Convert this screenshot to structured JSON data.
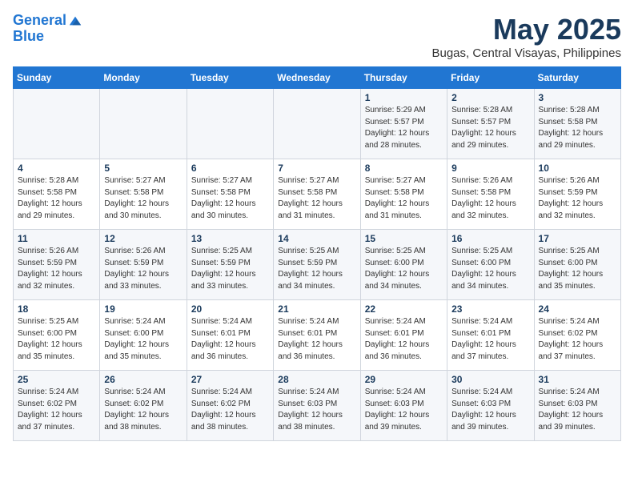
{
  "header": {
    "logo_line1": "General",
    "logo_line2": "Blue",
    "title": "May 2025",
    "subtitle": "Bugas, Central Visayas, Philippines"
  },
  "days_of_week": [
    "Sunday",
    "Monday",
    "Tuesday",
    "Wednesday",
    "Thursday",
    "Friday",
    "Saturday"
  ],
  "weeks": [
    [
      {
        "day": "",
        "sunrise": "",
        "sunset": "",
        "daylight": ""
      },
      {
        "day": "",
        "sunrise": "",
        "sunset": "",
        "daylight": ""
      },
      {
        "day": "",
        "sunrise": "",
        "sunset": "",
        "daylight": ""
      },
      {
        "day": "",
        "sunrise": "",
        "sunset": "",
        "daylight": ""
      },
      {
        "day": "1",
        "sunrise": "Sunrise: 5:29 AM",
        "sunset": "Sunset: 5:57 PM",
        "daylight": "Daylight: 12 hours and 28 minutes."
      },
      {
        "day": "2",
        "sunrise": "Sunrise: 5:28 AM",
        "sunset": "Sunset: 5:57 PM",
        "daylight": "Daylight: 12 hours and 29 minutes."
      },
      {
        "day": "3",
        "sunrise": "Sunrise: 5:28 AM",
        "sunset": "Sunset: 5:58 PM",
        "daylight": "Daylight: 12 hours and 29 minutes."
      }
    ],
    [
      {
        "day": "4",
        "sunrise": "Sunrise: 5:28 AM",
        "sunset": "Sunset: 5:58 PM",
        "daylight": "Daylight: 12 hours and 29 minutes."
      },
      {
        "day": "5",
        "sunrise": "Sunrise: 5:27 AM",
        "sunset": "Sunset: 5:58 PM",
        "daylight": "Daylight: 12 hours and 30 minutes."
      },
      {
        "day": "6",
        "sunrise": "Sunrise: 5:27 AM",
        "sunset": "Sunset: 5:58 PM",
        "daylight": "Daylight: 12 hours and 30 minutes."
      },
      {
        "day": "7",
        "sunrise": "Sunrise: 5:27 AM",
        "sunset": "Sunset: 5:58 PM",
        "daylight": "Daylight: 12 hours and 31 minutes."
      },
      {
        "day": "8",
        "sunrise": "Sunrise: 5:27 AM",
        "sunset": "Sunset: 5:58 PM",
        "daylight": "Daylight: 12 hours and 31 minutes."
      },
      {
        "day": "9",
        "sunrise": "Sunrise: 5:26 AM",
        "sunset": "Sunset: 5:58 PM",
        "daylight": "Daylight: 12 hours and 32 minutes."
      },
      {
        "day": "10",
        "sunrise": "Sunrise: 5:26 AM",
        "sunset": "Sunset: 5:59 PM",
        "daylight": "Daylight: 12 hours and 32 minutes."
      }
    ],
    [
      {
        "day": "11",
        "sunrise": "Sunrise: 5:26 AM",
        "sunset": "Sunset: 5:59 PM",
        "daylight": "Daylight: 12 hours and 32 minutes."
      },
      {
        "day": "12",
        "sunrise": "Sunrise: 5:26 AM",
        "sunset": "Sunset: 5:59 PM",
        "daylight": "Daylight: 12 hours and 33 minutes."
      },
      {
        "day": "13",
        "sunrise": "Sunrise: 5:25 AM",
        "sunset": "Sunset: 5:59 PM",
        "daylight": "Daylight: 12 hours and 33 minutes."
      },
      {
        "day": "14",
        "sunrise": "Sunrise: 5:25 AM",
        "sunset": "Sunset: 5:59 PM",
        "daylight": "Daylight: 12 hours and 34 minutes."
      },
      {
        "day": "15",
        "sunrise": "Sunrise: 5:25 AM",
        "sunset": "Sunset: 6:00 PM",
        "daylight": "Daylight: 12 hours and 34 minutes."
      },
      {
        "day": "16",
        "sunrise": "Sunrise: 5:25 AM",
        "sunset": "Sunset: 6:00 PM",
        "daylight": "Daylight: 12 hours and 34 minutes."
      },
      {
        "day": "17",
        "sunrise": "Sunrise: 5:25 AM",
        "sunset": "Sunset: 6:00 PM",
        "daylight": "Daylight: 12 hours and 35 minutes."
      }
    ],
    [
      {
        "day": "18",
        "sunrise": "Sunrise: 5:25 AM",
        "sunset": "Sunset: 6:00 PM",
        "daylight": "Daylight: 12 hours and 35 minutes."
      },
      {
        "day": "19",
        "sunrise": "Sunrise: 5:24 AM",
        "sunset": "Sunset: 6:00 PM",
        "daylight": "Daylight: 12 hours and 35 minutes."
      },
      {
        "day": "20",
        "sunrise": "Sunrise: 5:24 AM",
        "sunset": "Sunset: 6:01 PM",
        "daylight": "Daylight: 12 hours and 36 minutes."
      },
      {
        "day": "21",
        "sunrise": "Sunrise: 5:24 AM",
        "sunset": "Sunset: 6:01 PM",
        "daylight": "Daylight: 12 hours and 36 minutes."
      },
      {
        "day": "22",
        "sunrise": "Sunrise: 5:24 AM",
        "sunset": "Sunset: 6:01 PM",
        "daylight": "Daylight: 12 hours and 36 minutes."
      },
      {
        "day": "23",
        "sunrise": "Sunrise: 5:24 AM",
        "sunset": "Sunset: 6:01 PM",
        "daylight": "Daylight: 12 hours and 37 minutes."
      },
      {
        "day": "24",
        "sunrise": "Sunrise: 5:24 AM",
        "sunset": "Sunset: 6:02 PM",
        "daylight": "Daylight: 12 hours and 37 minutes."
      }
    ],
    [
      {
        "day": "25",
        "sunrise": "Sunrise: 5:24 AM",
        "sunset": "Sunset: 6:02 PM",
        "daylight": "Daylight: 12 hours and 37 minutes."
      },
      {
        "day": "26",
        "sunrise": "Sunrise: 5:24 AM",
        "sunset": "Sunset: 6:02 PM",
        "daylight": "Daylight: 12 hours and 38 minutes."
      },
      {
        "day": "27",
        "sunrise": "Sunrise: 5:24 AM",
        "sunset": "Sunset: 6:02 PM",
        "daylight": "Daylight: 12 hours and 38 minutes."
      },
      {
        "day": "28",
        "sunrise": "Sunrise: 5:24 AM",
        "sunset": "Sunset: 6:03 PM",
        "daylight": "Daylight: 12 hours and 38 minutes."
      },
      {
        "day": "29",
        "sunrise": "Sunrise: 5:24 AM",
        "sunset": "Sunset: 6:03 PM",
        "daylight": "Daylight: 12 hours and 39 minutes."
      },
      {
        "day": "30",
        "sunrise": "Sunrise: 5:24 AM",
        "sunset": "Sunset: 6:03 PM",
        "daylight": "Daylight: 12 hours and 39 minutes."
      },
      {
        "day": "31",
        "sunrise": "Sunrise: 5:24 AM",
        "sunset": "Sunset: 6:03 PM",
        "daylight": "Daylight: 12 hours and 39 minutes."
      }
    ]
  ]
}
